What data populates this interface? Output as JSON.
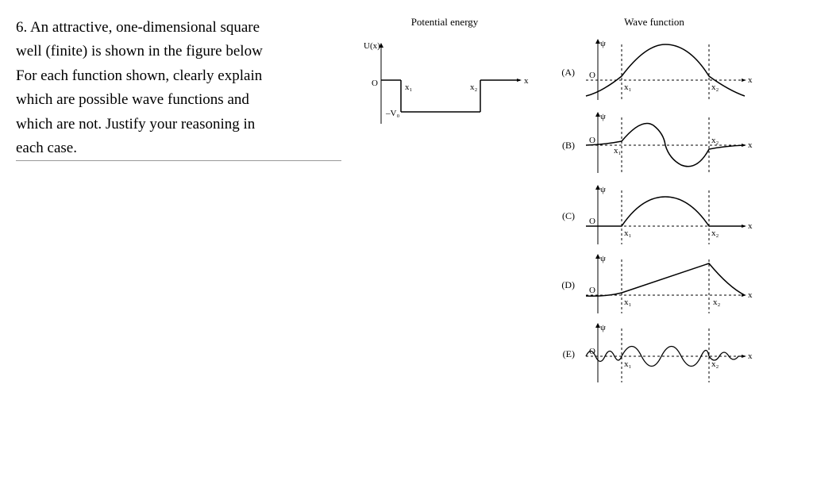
{
  "question": {
    "number": "6.",
    "line1": "An attractive, one-dimensional square",
    "line2": "well (finite) is shown in the figure below",
    "line3": "For each function shown, clearly explain",
    "line4": "which are possible wave functions and",
    "line5": "which are not. Justify your reasoning in",
    "line6": "each case."
  },
  "figure_titles": {
    "potential": "Potential energy",
    "wavefunction": "Wave function"
  },
  "potential": {
    "ylabel": "U(x)",
    "origin": "O",
    "x1": "x₁",
    "x2": "x₂",
    "depth": "–V₀",
    "xaxis": "x"
  },
  "wavefunctions": {
    "A": {
      "label": "(A)",
      "psi": "ψ",
      "o": "O",
      "x": "x",
      "x1": "x₁",
      "x2": "x₂"
    },
    "B": {
      "label": "(B)",
      "psi": "ψ",
      "o": "O",
      "x": "x",
      "x1": "x₁",
      "x2": "x₂"
    },
    "C": {
      "label": "(C)",
      "psi": "ψ",
      "o": "O",
      "x": "x",
      "x1": "x₁",
      "x2": "x₂"
    },
    "D": {
      "label": "(D)",
      "psi": "ψ",
      "o": "O",
      "x": "x",
      "x1": "x₁",
      "x2": "x₂"
    },
    "E": {
      "label": "(E)",
      "psi": "ψ",
      "o": "O",
      "x": "x",
      "x1": "x₁",
      "x2": "x₂"
    }
  }
}
